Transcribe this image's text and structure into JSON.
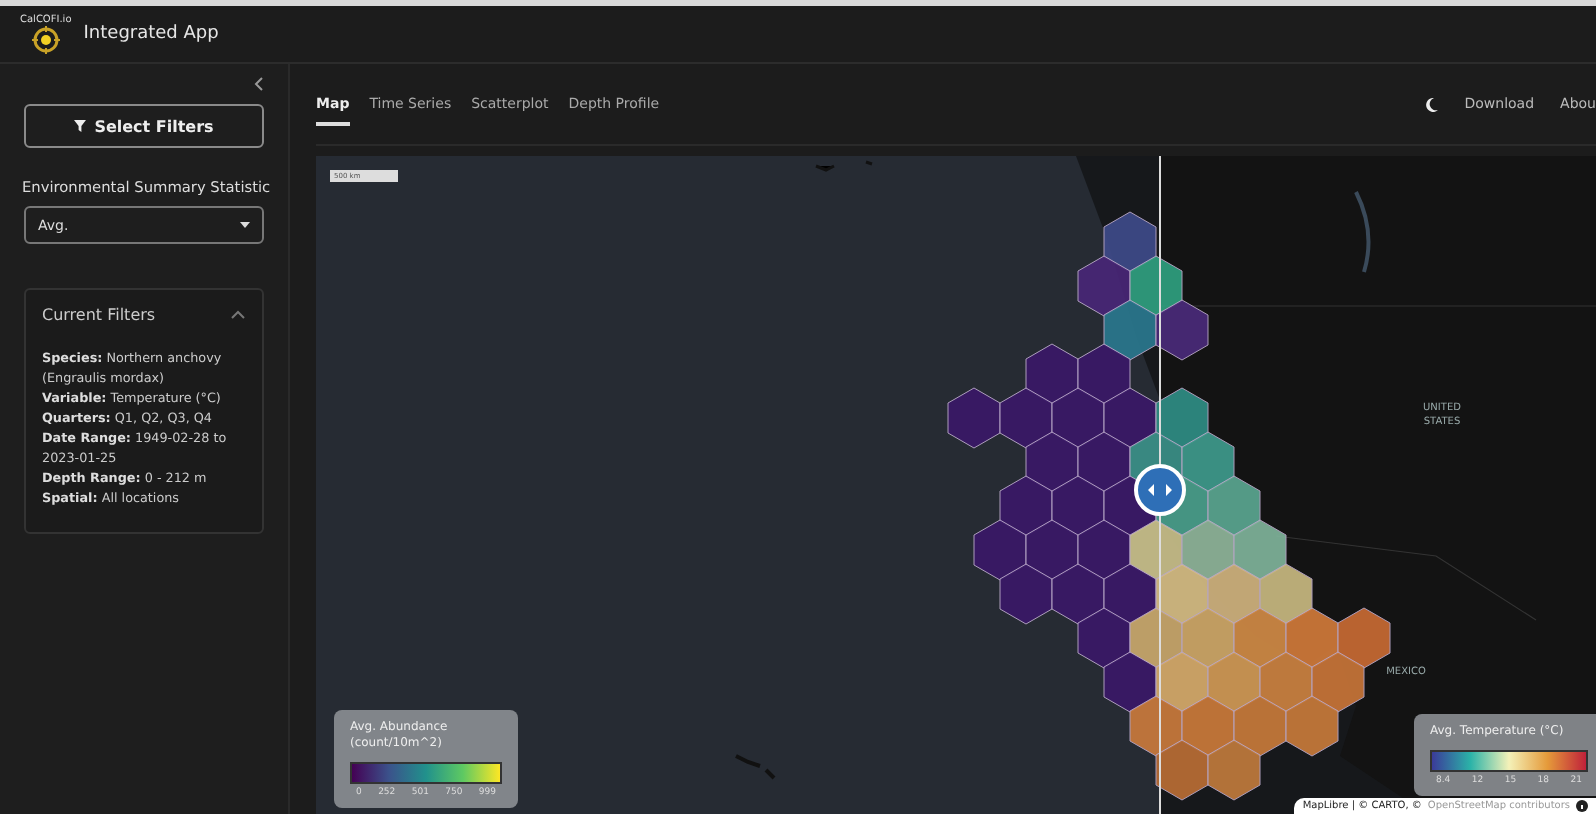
{
  "header": {
    "logo_text": "CalCOFI.io",
    "title": "Integrated App"
  },
  "sidebar": {
    "collapsed": false,
    "filter_button": "Select Filters",
    "statistic_label": "Environmental Summary Statistic",
    "statistic_value": "Avg.",
    "filters_card": {
      "title": "Current Filters",
      "expanded": true,
      "items": [
        {
          "label": "Species:",
          "value": "Northern anchovy (Engraulis mordax)"
        },
        {
          "label": "Variable:",
          "value": "Temperature (°C)"
        },
        {
          "label": "Quarters:",
          "value": "Q1, Q2, Q3, Q4"
        },
        {
          "label": "Date Range:",
          "value": "1949-02-28 to 2023-01-25"
        },
        {
          "label": "Depth Range:",
          "value": "0 - 212 m"
        },
        {
          "label": "Spatial:",
          "value": "All locations"
        }
      ]
    }
  },
  "tabs": [
    {
      "label": "Map",
      "selected": true
    },
    {
      "label": "Time Series",
      "selected": false
    },
    {
      "label": "Scatterplot",
      "selected": false
    },
    {
      "label": "Depth Profile",
      "selected": false
    }
  ],
  "nav_links": [
    "Download",
    "Abou"
  ],
  "map": {
    "scale_label": "500 km",
    "place_labels": [
      "UNITED STATES",
      "MEXICO"
    ],
    "legends": [
      {
        "title": "Avg. Abundance (count/10m^2)",
        "kind": "abundance",
        "ticks": [
          "0",
          "252",
          "501",
          "750",
          "999"
        ]
      },
      {
        "title": "Avg. Temperature (°C)",
        "kind": "temperature",
        "ticks": [
          "8.4",
          "12",
          "15",
          "18",
          "21"
        ]
      }
    ],
    "attribution": {
      "text": "MapLibre | © CARTO, © ",
      "link": "OpenStreetMap contributors"
    }
  }
}
